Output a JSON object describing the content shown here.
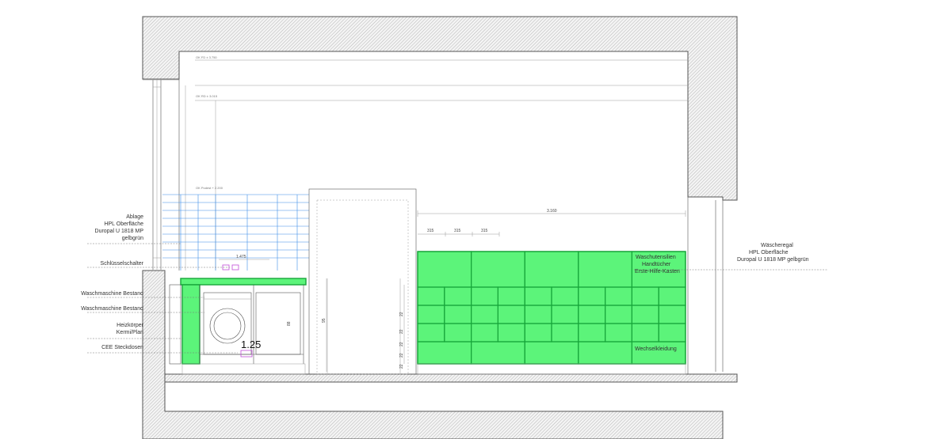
{
  "labels_left": [
    {
      "id": "ablage",
      "lines": [
        "Ablage",
        "HPL Oberfläche",
        "Duropal U 1818 MP",
        "gelbgrün"
      ]
    },
    {
      "id": "schluesselschalter",
      "lines": [
        "Schlüsselschalter"
      ]
    },
    {
      "id": "waschmaschine-1",
      "lines": [
        "Waschmaschine Bestand"
      ]
    },
    {
      "id": "waschmaschine-2",
      "lines": [
        "Waschmaschine Bestand"
      ]
    },
    {
      "id": "heizkoerper",
      "lines": [
        "Heizkörper",
        "Kermi/Plan"
      ]
    },
    {
      "id": "cee",
      "lines": [
        "CEE Steckdosen"
      ]
    }
  ],
  "labels_right": {
    "waescheregal": [
      "Wäscheregal",
      "HPL Oberfläche",
      "Duropal U 1818 MP gelbgrün"
    ]
  },
  "shelf_labels": {
    "top": [
      "Waschutensilien",
      "Handtücher",
      "Erste-Hilfe-Kasten"
    ],
    "bottom": "Wechselkleidung"
  },
  "dimensions": {
    "shelf_width": "3.160",
    "module_widths": [
      "315",
      "315",
      "315"
    ],
    "counter_width": "1.475",
    "door_height": "95",
    "counter_depth": "88",
    "shelf_rows": [
      "22",
      "22",
      "22",
      "22",
      "22"
    ],
    "ok_1": "OK FD ± 3.750",
    "ok_2": "OK RD ± 3.015",
    "ok_stair": "OK Podest + 2.200"
  },
  "scale_label": "1.25",
  "colors": {
    "accent_green": "#5cf47a",
    "green_stroke": "#17a63a",
    "guide_blue": "#3d8ee8",
    "marker_purple": "#c04fd8"
  }
}
